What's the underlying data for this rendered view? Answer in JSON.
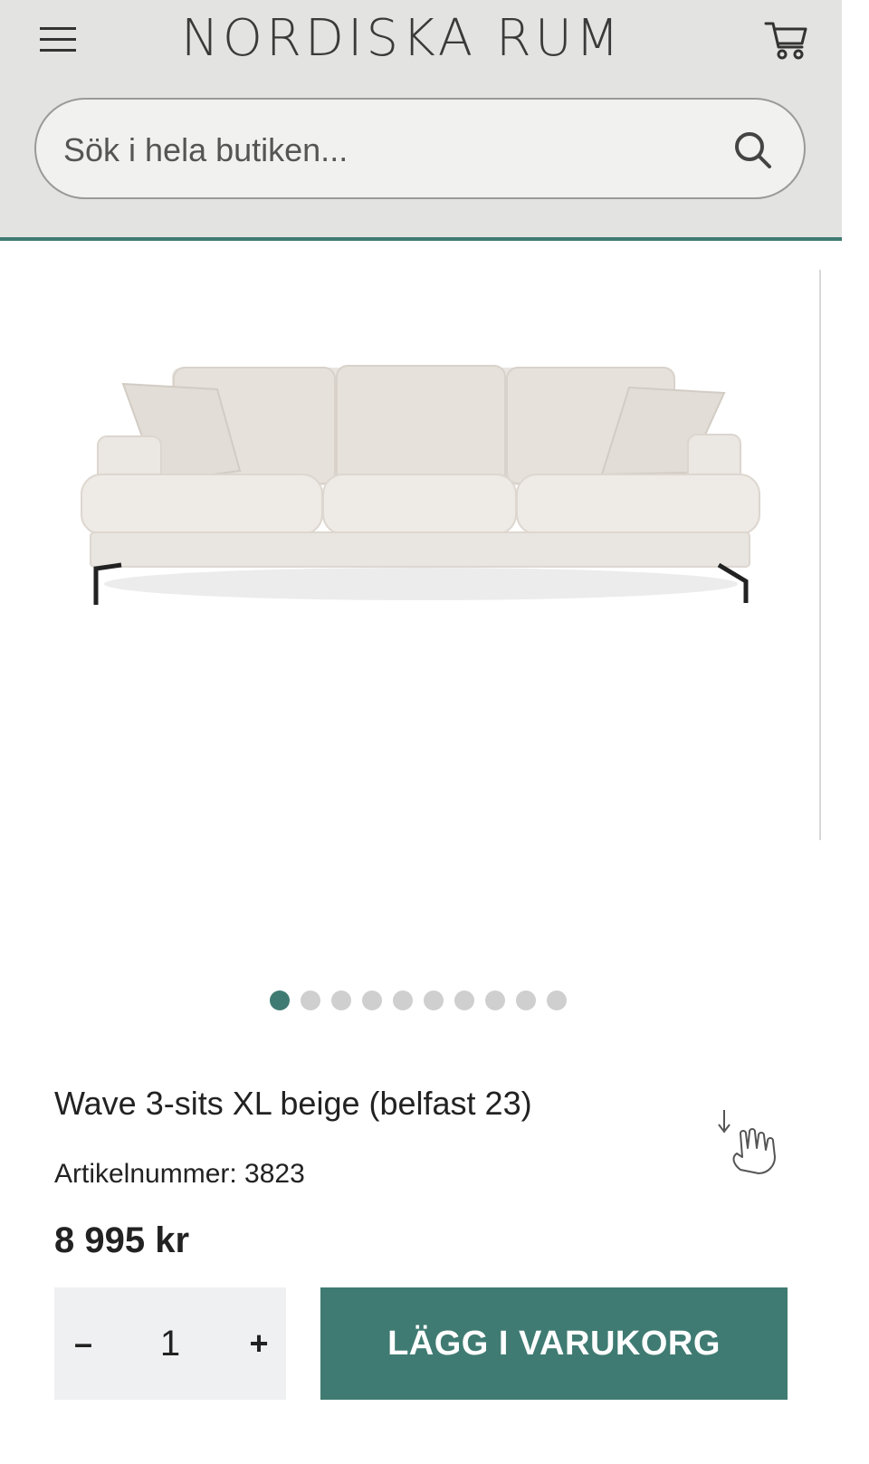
{
  "header": {
    "logo_text": "NORDISKA RUM",
    "menu_icon": "hamburger-menu-icon",
    "cart_icon": "cart-icon"
  },
  "search": {
    "placeholder": "Sök i hela butiken...",
    "value": "",
    "icon": "search-icon"
  },
  "gallery": {
    "image": "sofa-product-image",
    "dot_count": 10,
    "active_index": 0
  },
  "product": {
    "title": "Wave 3-sits XL beige (belfast 23)",
    "sku_label": "Artikelnummer:",
    "sku_value": "3823",
    "price": "8 995 kr"
  },
  "purchase": {
    "qty_minus": "–",
    "qty_value": "1",
    "qty_plus": "+",
    "add_to_cart_label": "LÄGG I VARUKORG"
  },
  "colors": {
    "accent": "#3f7b72",
    "header_bg": "#e3e3e1",
    "dot_inactive": "#cfcfcf",
    "qty_bg": "#eff0f2"
  }
}
